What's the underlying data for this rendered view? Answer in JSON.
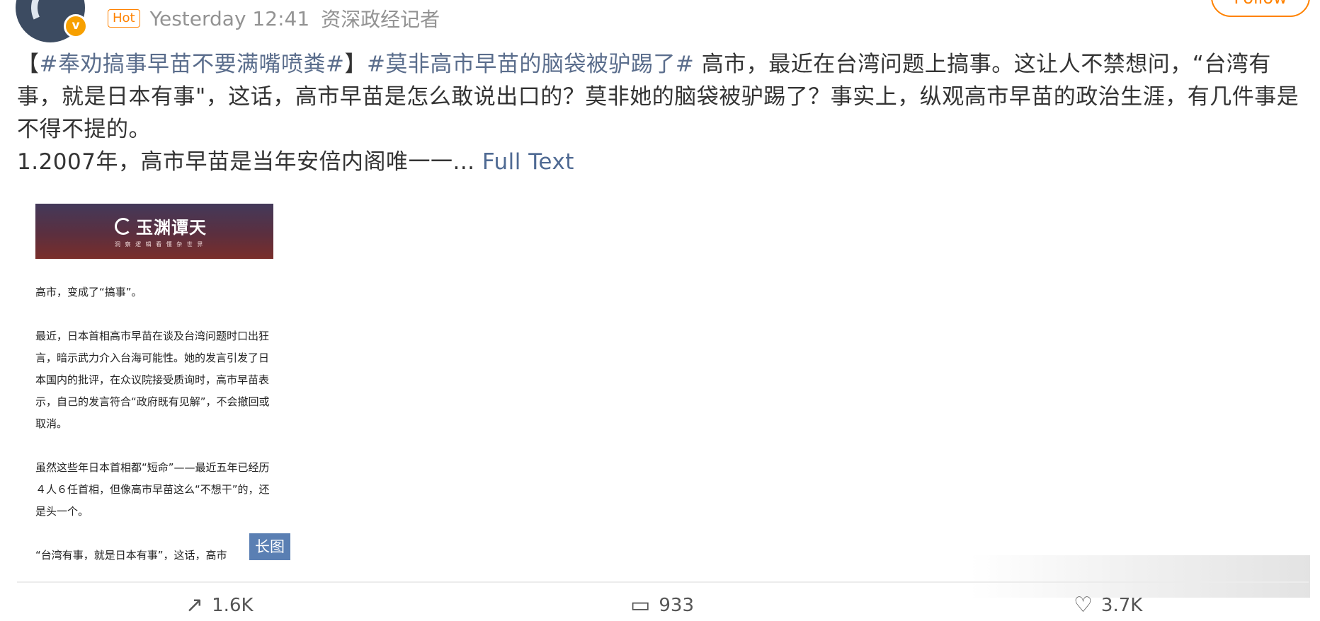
{
  "header": {
    "hot_label": "Hot",
    "time": "Yesterday 12:41",
    "source": "资深政经记者",
    "follow_label": "Follow"
  },
  "post": {
    "bracket_open": "【",
    "tag1": "#奉劝搞事早苗不要满嘴喷粪#",
    "bracket_close": "】",
    "tag2": "#莫非高市早苗的脑袋被驴踢了#",
    "body": " 高市，最近在台湾问题上搞事。这让人不禁想问，“台湾有事，就是日本有事\"，这话，高市早苗是怎么敢说出口的？莫非她的脑袋被驴踢了？事实上，纵观高市早苗的政治生涯，有几件事是不得不提的。",
    "line2": "1.2007年，高市早苗是当年安倍内阁唯一一...",
    "full_text_label": " Full Text"
  },
  "image_card": {
    "brand_name": "玉渊谭天",
    "brand_sub": "洞 察 逻 辑 看 懂 杂 世 界",
    "p1": "高市，变成了“搞事”。",
    "p2": "最近，日本首相高市早苗在谈及台湾问题时口出狂言，暗示武力介入台海可能性。她的发言引发了日本国内的批评，在众议院接受质询时，高市早苗表示，自己的发言符合“政府既有见解”，不会撤回或取消。",
    "p3": "虽然这些年日本首相都“短命”——最近五年已经历４人６任首相，但像高市早苗这么“不想干”的，还是头一个。",
    "p4": "“台湾有事，就是日本有事”，这话，高市",
    "long_image_label": "长图"
  },
  "actions": {
    "share_icon": "share-icon",
    "share_count": "1.6K",
    "comment_icon": "comment-icon",
    "comment_count": "933",
    "like_icon": "like-icon",
    "like_count": "3.7K"
  },
  "colors": {
    "accent": "#ff8200",
    "link": "#5a6d8c",
    "meta": "#939393"
  }
}
